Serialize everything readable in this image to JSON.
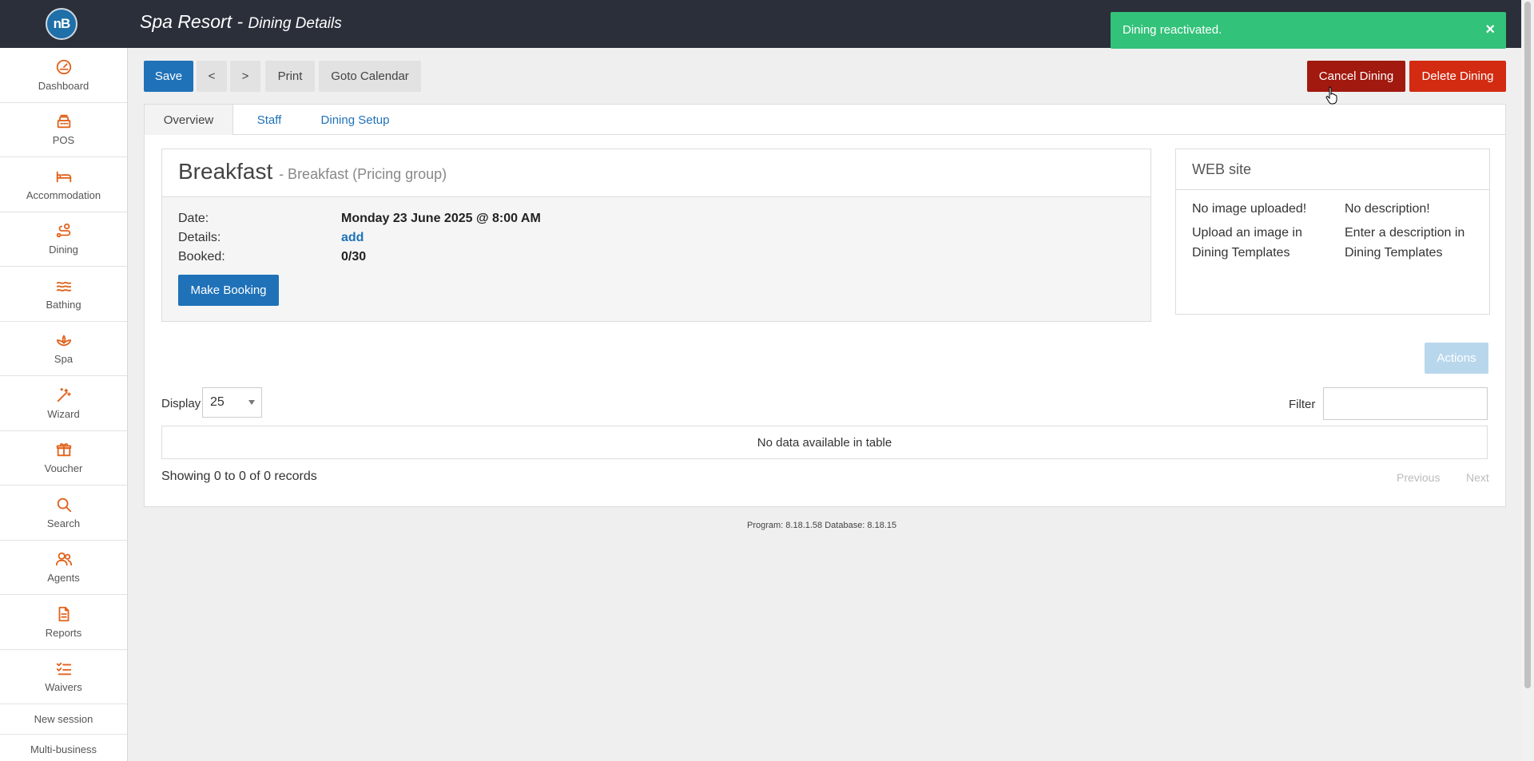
{
  "header": {
    "app_title": "Spa Resort",
    "separator": " - ",
    "page_subtitle": "Dining Details",
    "logo_text": "nB"
  },
  "sidebar": {
    "items": [
      {
        "label": "Dashboard",
        "icon": "gauge-icon"
      },
      {
        "label": "POS",
        "icon": "cash-register-icon"
      },
      {
        "label": "Accommodation",
        "icon": "bed-icon"
      },
      {
        "label": "Dining",
        "icon": "route-icon"
      },
      {
        "label": "Bathing",
        "icon": "water-icon"
      },
      {
        "label": "Spa",
        "icon": "lotus-icon"
      },
      {
        "label": "Wizard",
        "icon": "magic-wand-icon"
      },
      {
        "label": "Voucher",
        "icon": "gift-icon"
      },
      {
        "label": "Search",
        "icon": "search-icon"
      },
      {
        "label": "Agents",
        "icon": "users-icon"
      },
      {
        "label": "Reports",
        "icon": "document-icon"
      },
      {
        "label": "Waivers",
        "icon": "checklist-icon"
      }
    ],
    "links": [
      "New session",
      "Multi-business"
    ]
  },
  "toolbar": {
    "save": "Save",
    "prev": "<",
    "next": ">",
    "print": "Print",
    "goto_calendar": "Goto Calendar",
    "cancel_dining": "Cancel Dining",
    "delete_dining": "Delete Dining"
  },
  "toast": {
    "message": "Dining reactivated.",
    "close": "×",
    "color": "#33c27a"
  },
  "tabs": [
    "Overview",
    "Staff",
    "Dining Setup"
  ],
  "dining": {
    "title": "Breakfast",
    "subtitle": "- Breakfast (Pricing group)",
    "date_label": "Date:",
    "date_value": "Monday 23 June 2025 @ 8:00 AM",
    "details_label": "Details:",
    "details_value": "add",
    "booked_label": "Booked:",
    "booked_value": "0/30",
    "make_booking": "Make Booking"
  },
  "web_site": {
    "heading": "WEB site",
    "image_status": "No image uploaded!",
    "image_hint": "Upload an image in",
    "image_link": "Dining Templates",
    "desc_status": "No description!",
    "desc_hint": "Enter a description in",
    "desc_link": "Dining Templates"
  },
  "table": {
    "actions": "Actions",
    "display_label": "Display",
    "page_size": "25",
    "filter_label": "Filter",
    "filter_value": "",
    "empty_message": "No data available in table",
    "records_info": "Showing 0 to 0 of 0 records",
    "previous": "Previous",
    "next": "Next"
  },
  "footer": {
    "version": "Program: 8.18.1.58 Database: 8.18.15"
  },
  "colors": {
    "topbar": "#2b2f3a",
    "accent_icon": "#e2621c",
    "primary": "#1f72b8",
    "cancel": "#a1190f",
    "delete": "#d22b12"
  }
}
